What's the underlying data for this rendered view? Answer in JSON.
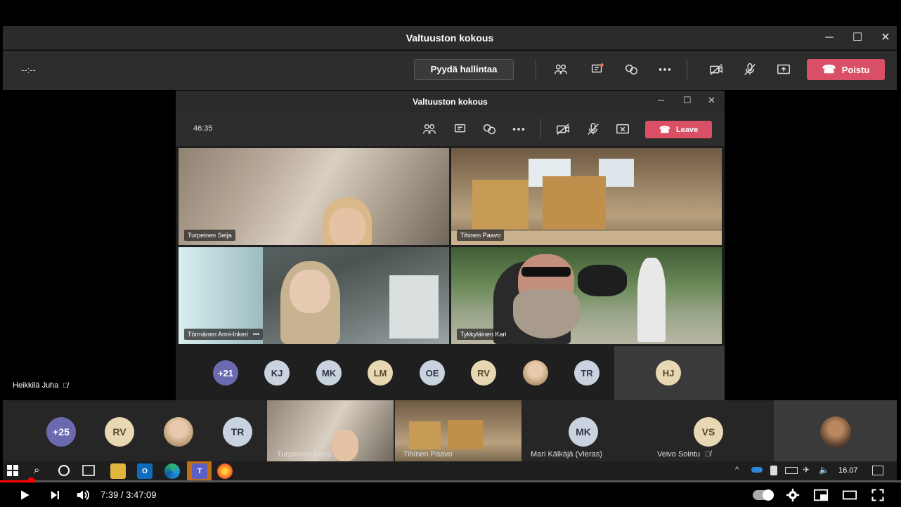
{
  "outer_window": {
    "title": "Valtuuston kokous",
    "controls": [
      "─",
      "☐",
      "✕"
    ],
    "timer": "--:--",
    "request_control_label": "Pyydä hallintaa",
    "leave_label": "Poistu"
  },
  "inner_window": {
    "title": "Valtuuston kokous",
    "timer": "46:35",
    "leave_label": "Leave"
  },
  "self_label": "Heikkilä Juha",
  "video_tiles": [
    {
      "name": "Turpeinen Seija"
    },
    {
      "name": "Tihinen Paavo"
    },
    {
      "name": "Törmänen Anni-Inkeri"
    },
    {
      "name": "Tykkyläinen Kari"
    }
  ],
  "inner_more_indicator": "•••",
  "inner_participants": [
    "+21",
    "KJ",
    "MK",
    "LM",
    "OE",
    "RV",
    "",
    "TR"
  ],
  "inner_highlight": "HJ",
  "bottom_strip": {
    "avatars": [
      "+25",
      "RV",
      "",
      "TR"
    ],
    "video_names": [
      "Turpeinen Seija",
      "Tihinen Paavo"
    ],
    "named_avatars": [
      {
        "initials": "MK",
        "name": "Mari Kälkäjä (Vieras)"
      },
      {
        "initials": "VS",
        "name": "Veivo Sointu"
      }
    ]
  },
  "taskbar": {
    "clock": "16.07"
  },
  "player": {
    "time": "7:39 / 3:47:09",
    "progress_fraction": 0.034
  },
  "colors": {
    "leave_red": "#d94f65",
    "teams_purple": "#6b6ab0",
    "progress_red": "#ff0000"
  }
}
